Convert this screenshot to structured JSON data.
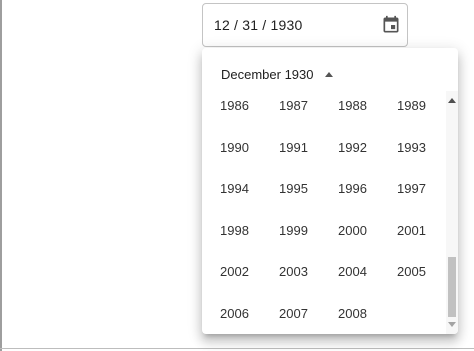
{
  "date_field": {
    "value": "12 / 31 / 1930",
    "icon": "calendar-icon"
  },
  "picker": {
    "header_label": "December 1930",
    "header_icon": "caret-up-icon",
    "years": [
      "1986",
      "1987",
      "1988",
      "1989",
      "1990",
      "1991",
      "1992",
      "1993",
      "1994",
      "1995",
      "1996",
      "1997",
      "1998",
      "1999",
      "2000",
      "2001",
      "2002",
      "2003",
      "2004",
      "2005",
      "2006",
      "2007",
      "2008"
    ]
  },
  "colors": {
    "text": "#212121",
    "border": "#c4c4c4",
    "icon": "#555555"
  }
}
